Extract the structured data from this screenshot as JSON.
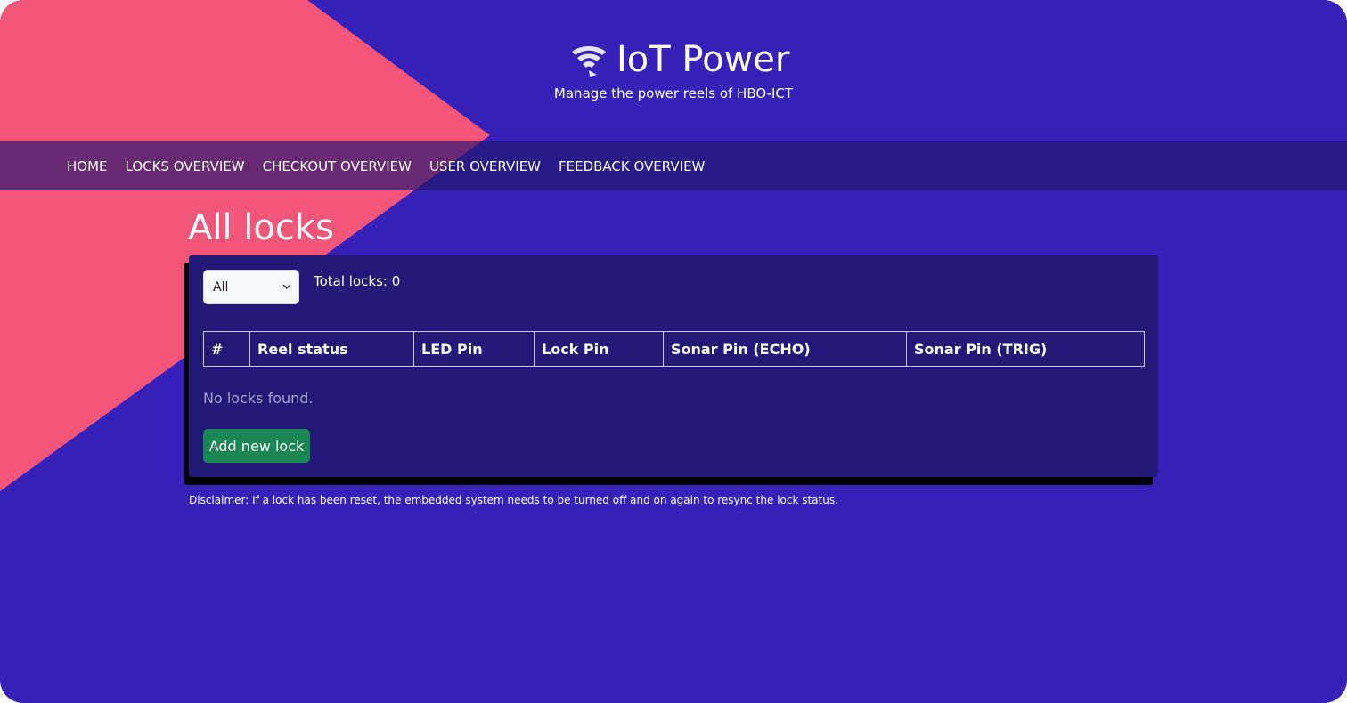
{
  "brand": {
    "title": "IoT Power",
    "subtitle": "Manage the power reels of HBO-ICT",
    "logo_icon": "wifi-reel-icon"
  },
  "nav": {
    "items": [
      {
        "label": "HOME"
      },
      {
        "label": "LOCKS OVERVIEW"
      },
      {
        "label": "CHECKOUT OVERVIEW"
      },
      {
        "label": "USER OVERVIEW"
      },
      {
        "label": "FEEDBACK OVERVIEW"
      }
    ]
  },
  "page": {
    "title": "All locks"
  },
  "filter": {
    "selected": "All"
  },
  "summary": {
    "total_locks": "Total locks: 0"
  },
  "table": {
    "headers": [
      "#",
      "Reel status",
      "LED Pin",
      "Lock Pin",
      "Sonar Pin (ECHO)",
      "Sonar Pin (TRIG)"
    ],
    "rows": []
  },
  "empty_message": "No locks found.",
  "actions": {
    "add_lock": "Add new lock"
  },
  "disclaimer": "Disclaimer: If a lock has been reset, the embedded system needs to be turned off and on again to resync the lock status.",
  "colors": {
    "background": "#3620b8",
    "accent_triangle": "#f4567a",
    "card": "#221878",
    "button": "#198754"
  }
}
